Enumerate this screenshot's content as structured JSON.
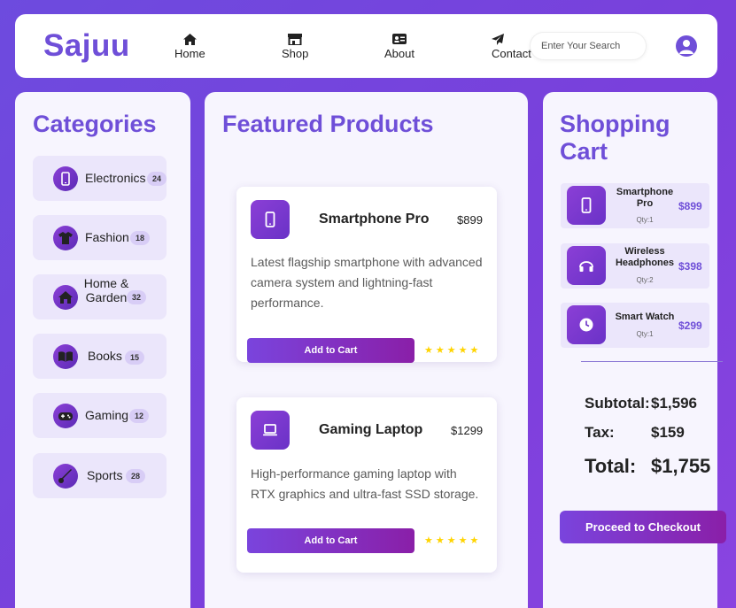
{
  "header": {
    "logo": "Sajuu",
    "nav": [
      {
        "label": "Home",
        "icon": "home-icon"
      },
      {
        "label": "Shop",
        "icon": "shop-icon"
      },
      {
        "label": "About",
        "icon": "id-card-icon"
      },
      {
        "label": "Contact",
        "icon": "paper-plane-icon"
      }
    ],
    "search_placeholder": "Enter Your Search",
    "avatar_icon": "user-icon"
  },
  "categories": {
    "title": "Categories",
    "items": [
      {
        "label": "Electronics",
        "count": "24",
        "icon": "phone-icon"
      },
      {
        "label": "Fashion",
        "count": "18",
        "icon": "shirt-icon"
      },
      {
        "label": "Home & Garden",
        "count": "32",
        "icon": "house-icon"
      },
      {
        "label": "Books",
        "count": "15",
        "icon": "book-icon"
      },
      {
        "label": "Gaming",
        "count": "12",
        "icon": "gamepad-icon"
      },
      {
        "label": "Sports",
        "count": "28",
        "icon": "sports-icon"
      }
    ]
  },
  "featured": {
    "title": "Featured Products",
    "products": [
      {
        "name": "Smartphone Pro",
        "price": "$899",
        "description": "Latest flagship smartphone with advanced camera system and lightning-fast performance.",
        "button": "Add to Cart",
        "rating": 5,
        "stars": "★★★★★",
        "icon": "phone-icon"
      },
      {
        "name": "Gaming Laptop",
        "price": "$1299",
        "description": "High-performance gaming laptop with RTX graphics and ultra-fast SSD storage.",
        "button": "Add to Cart",
        "rating": 5,
        "stars": "★★★★★",
        "icon": "laptop-icon"
      }
    ]
  },
  "cart": {
    "title_line1": "Shopping",
    "title_line2": "Cart",
    "items": [
      {
        "name": "Smartphone Pro",
        "qty": "Qty:1",
        "price": "$899",
        "icon": "phone-icon"
      },
      {
        "name": "Wireless Headphones",
        "qty": "Qty:2",
        "price": "$398",
        "icon": "headphones-icon"
      },
      {
        "name": "Smart Watch",
        "qty": "Qty:1",
        "price": "$299",
        "icon": "clock-icon"
      }
    ],
    "subtotal_label": "Subtotal:",
    "subtotal_value": "$1,596",
    "tax_label": "Tax:",
    "tax_value": "$159",
    "total_label": "Total:",
    "total_value": "$1,755",
    "checkout_label": "Proceed to Checkout"
  },
  "colors": {
    "accent": "#6f4fd8",
    "background_gradient_start": "#6d4bde",
    "star": "#ffd400"
  }
}
